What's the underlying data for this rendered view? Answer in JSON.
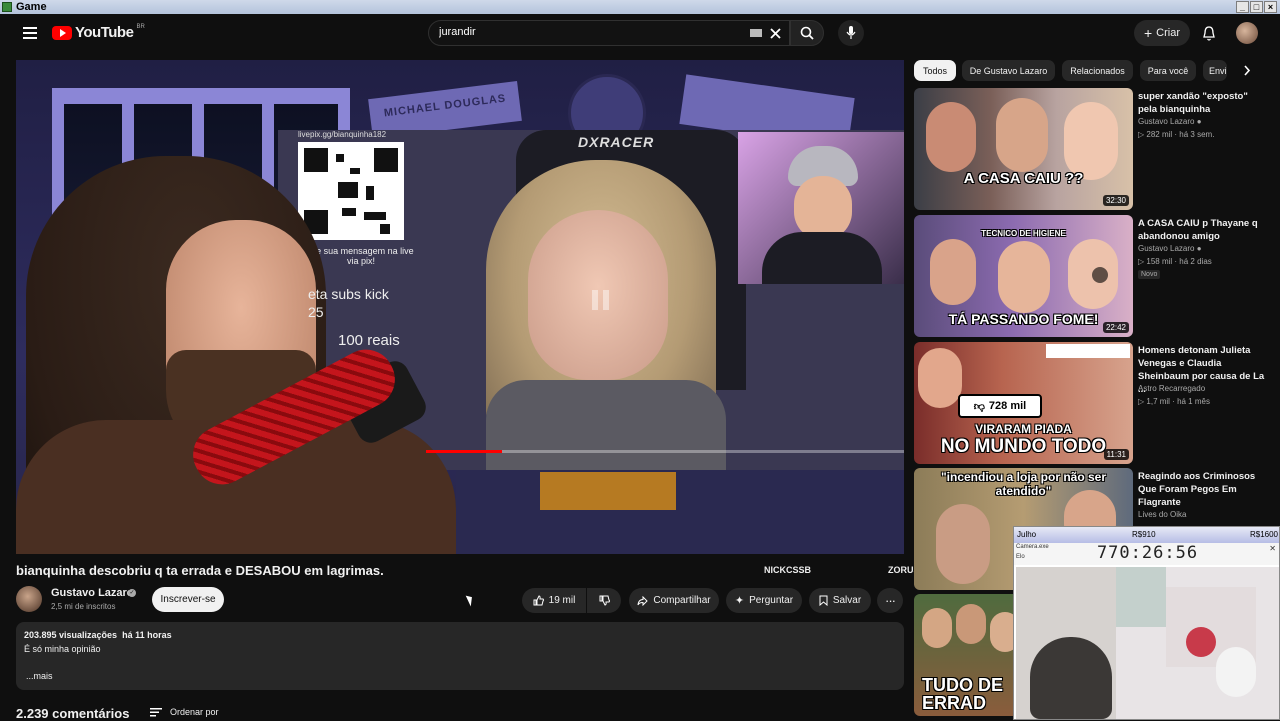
{
  "window": {
    "title": "Game"
  },
  "header": {
    "logo_text": "YouTube",
    "logo_country": "BR",
    "search_value": "jurandir",
    "create_label": "Criar"
  },
  "player": {
    "overlay_small": "livepix.gg/bianquinha182",
    "overlay_caption": "Vie sua mensagem na live via pix!",
    "overlay_subs": "eta subs kick",
    "overlay_num": "25",
    "overlay_reais": "100 reais",
    "poster_left": "MICHAEL DOUGLAS",
    "chair_brand": "DXRACER",
    "progress_fraction": 0.16,
    "corner_left": "NICKCSSB",
    "corner_right": "ZORUSSP"
  },
  "video": {
    "title": "bianquinha descobriu q ta errada e DESABOU em lagrimas.",
    "channel_name": "Gustavo Lazaro",
    "channel_subs": "2,5 mi de inscritos",
    "subscribe_label": "Inscrever-se",
    "likes": "19 mil",
    "share_label": "Compartilhar",
    "ask_label": "Perguntar",
    "save_label": "Salvar"
  },
  "description": {
    "views": "203.895 visualizações",
    "time": "há 11 horas",
    "text": "É só minha opinião",
    "more": "...mais"
  },
  "comments": {
    "count": "2.239 comentários",
    "sort_label": "Ordenar por"
  },
  "chips": [
    "Todos",
    "De Gustavo Lazaro",
    "Relacionados",
    "Para você",
    "Envi"
  ],
  "recommended": [
    {
      "title": "super xandão \"exposto\" pela bianquinha",
      "channel": "Gustavo Lazaro",
      "views": "282 mil",
      "age": "há 3 sem.",
      "duration": "32:30",
      "thumb_text": "A CASA CAIU ??",
      "badge": ""
    },
    {
      "title": "A CASA CAIU p Thayane q abandonou amigo",
      "channel": "Gustavo Lazaro",
      "views": "158 mil",
      "age": "há 2 dias",
      "duration": "22:42",
      "thumb_text": "TÁ PASSANDO FOME!",
      "thumb_top": "TECNICO DE HIGIENE",
      "badge": "Novo"
    },
    {
      "title": "Homens detonam Julieta Venegas e Claudia Sheinbaum por causa de La ...",
      "channel": "Astro Recarregado",
      "views": "1,7 mil",
      "age": "há 1 mês",
      "duration": "11:31",
      "thumb_text": "NO MUNDO TODO",
      "thumb_mid": "VIRARAM PIADA",
      "thumb_likes": "728 mil",
      "badge": ""
    },
    {
      "title": "Reagindo aos Criminosos Que Foram Pegos Em Flagrante",
      "channel": "Lives do Oika",
      "views": "",
      "age": "",
      "duration": "",
      "thumb_text": "\"incendiou a loja por não ser atendido\"",
      "badge": ""
    },
    {
      "title": "",
      "channel": "",
      "views": "",
      "age": "",
      "duration": "",
      "thumb_text": "TUDO DE ERRAD",
      "badge": ""
    }
  ],
  "cam_widget": {
    "bar_label": "Julho",
    "bar_val1": "R$910",
    "bar_val2": "R$1600",
    "timer": "770:26:56",
    "title": "Camera.exe",
    "sub": "Elo"
  },
  "colors": {
    "accent": "#ff0000",
    "bg": "#0f0f0f",
    "chip_bg": "#272727"
  }
}
